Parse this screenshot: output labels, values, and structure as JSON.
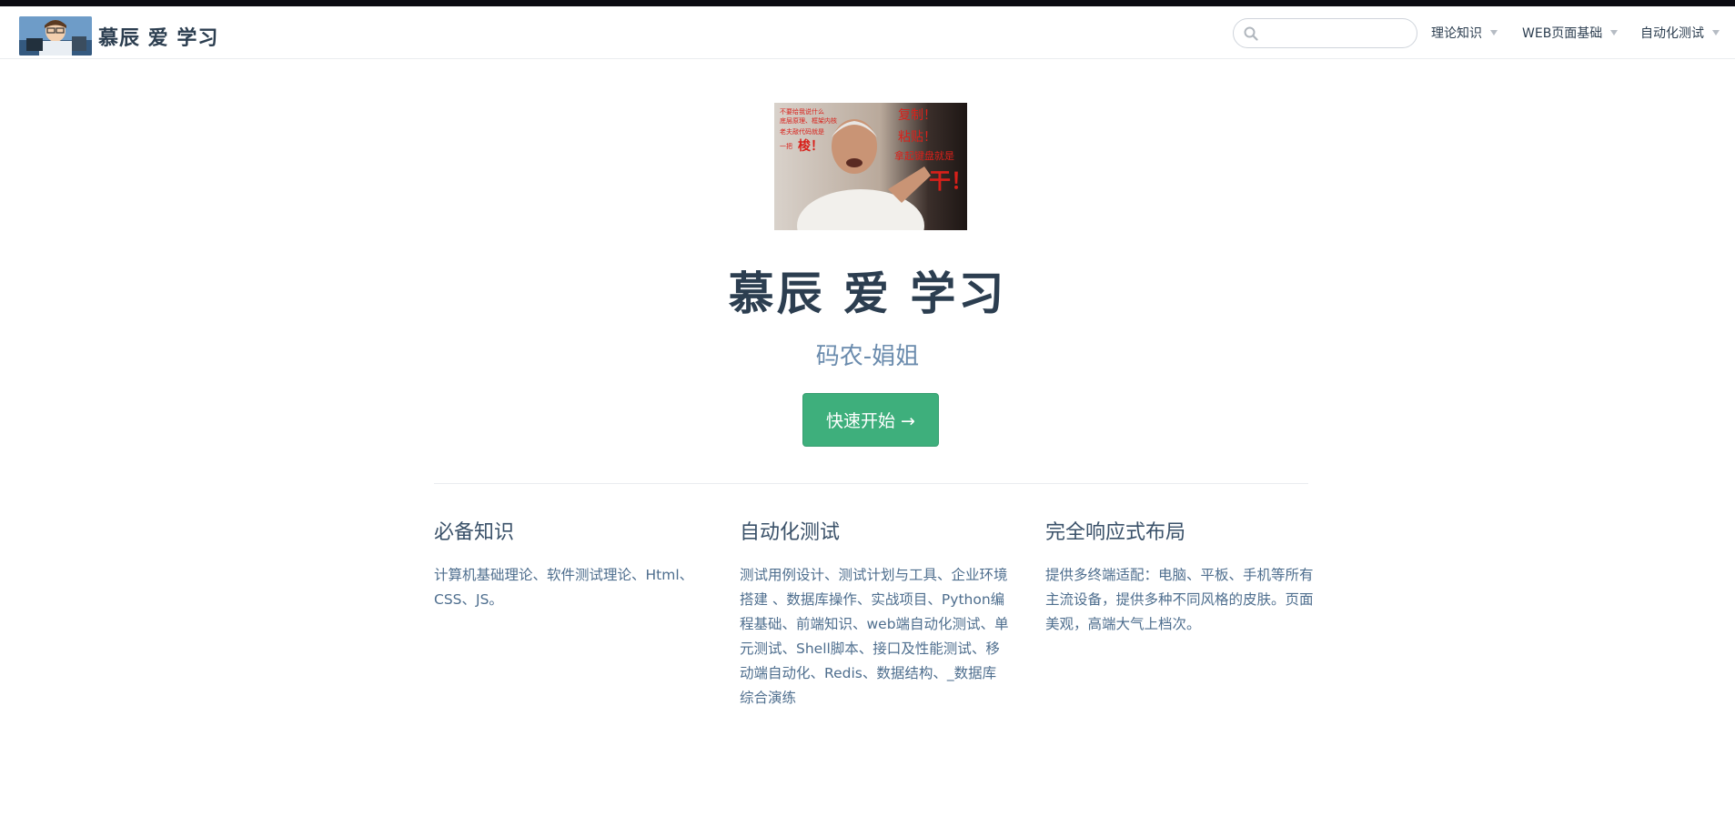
{
  "site": {
    "name": "慕辰 爱 学习"
  },
  "search": {
    "placeholder": "",
    "value": ""
  },
  "nav": {
    "items": [
      {
        "label": "理论知识"
      },
      {
        "label": "WEB页面基础"
      },
      {
        "label": "自动化测试"
      }
    ]
  },
  "hero": {
    "title": "慕辰 爱 学习",
    "description": "码农-娟姐",
    "action_label": "快速开始 →",
    "image_text": {
      "small_lines": [
        "不要给我说什么",
        "底层原理、框架内核",
        "老夫敲代码就是",
        "一把"
      ],
      "big_word_left": "梭！",
      "right_lines": [
        "复制！",
        "粘贴！",
        "拿起键盘就是"
      ],
      "big_word_right": "干！"
    }
  },
  "features": [
    {
      "title": "必备知识",
      "details": "计算机基础理论、软件测试理论、Html、CSS、JS。"
    },
    {
      "title": "自动化测试",
      "details": "测试用例设计、测试计划与工具、企业环境搭建 、数据库操作、实战项目、Python编程基础、前端知识、web端自动化测试、单元测试、Shell脚本、接口及性能测试、移动端自动化、Redis、数据结构、_数据库综合演练"
    },
    {
      "title": "完全响应式布局",
      "details": "提供多终端适配：电脑、平板、手机等所有主流设备，提供多种不同风格的皮肤。页面美观，高端大气上档次。"
    }
  ],
  "colors": {
    "accent": "#3eaf7c",
    "text": "#2c3e50",
    "description": "#6a8bad",
    "meme_red": "#d8201a"
  },
  "icons": {
    "search": "magnifier",
    "dropdown": "caret-down"
  }
}
